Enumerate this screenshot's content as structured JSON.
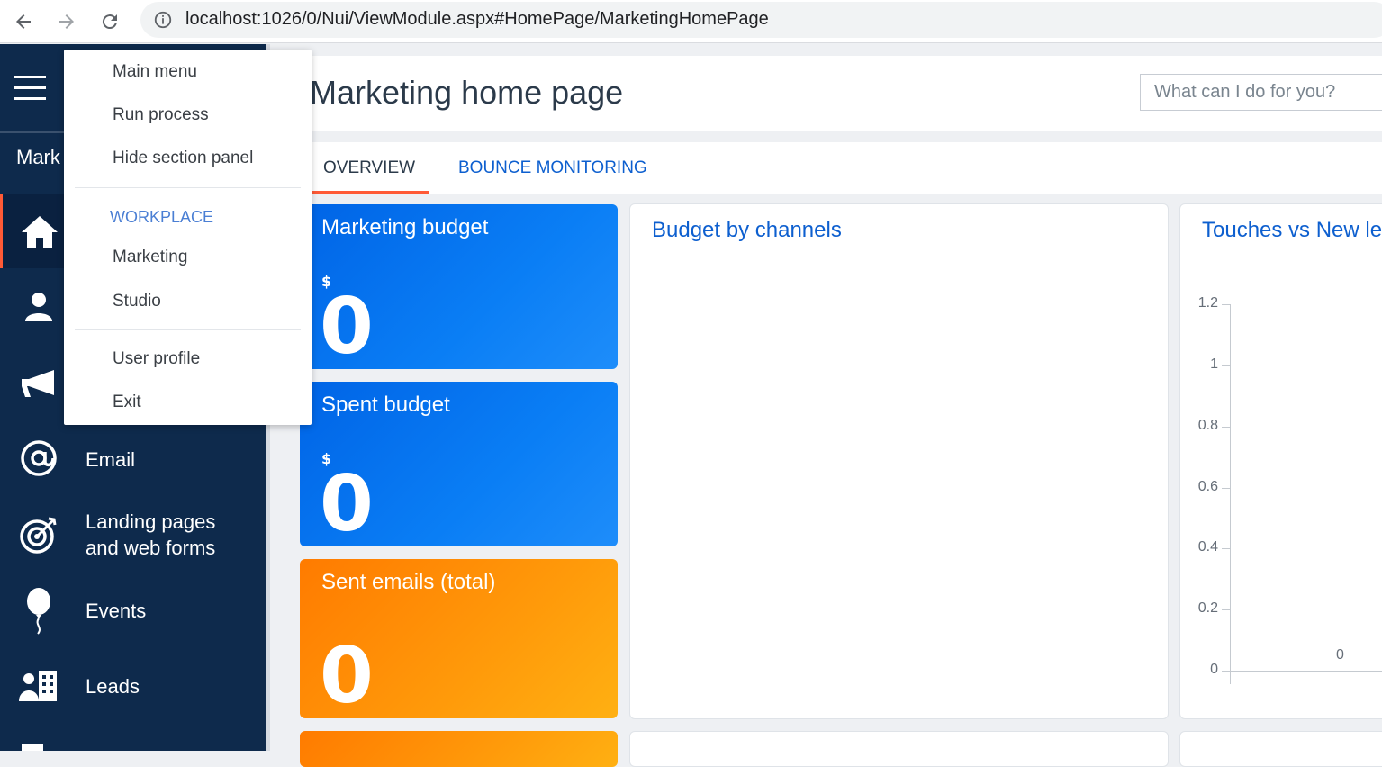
{
  "browser": {
    "url": "localhost:1026/0/Nui/ViewModule.aspx#HomePage/MarketingHomePage"
  },
  "sidebar": {
    "section_label": "Mark",
    "items": [
      {
        "label": "Email",
        "icon": "at-icon"
      },
      {
        "label": "Landing pages and web forms",
        "line1": "Landing pages",
        "line2": "and web forms",
        "icon": "target-icon"
      },
      {
        "label": "Events",
        "icon": "balloon-icon"
      },
      {
        "label": "Leads",
        "icon": "leads-icon"
      }
    ]
  },
  "header": {
    "title": "Marketing home page",
    "search_placeholder": "What can I do for you?"
  },
  "tabs": [
    {
      "label": "OVERVIEW",
      "active": true
    },
    {
      "label": "BOUNCE MONITORING",
      "active": false
    }
  ],
  "tiles": [
    {
      "title": "Marketing budget",
      "currency": "$",
      "value": "0"
    },
    {
      "title": "Spent budget",
      "currency": "$",
      "value": "0"
    },
    {
      "title": "Sent emails (total)",
      "value": "0"
    }
  ],
  "cards": {
    "budget_title": "Budget by channels",
    "touches_title": "Touches vs New le"
  },
  "chart_data": {
    "type": "bar",
    "title": "Touches vs New le",
    "yticks": [
      "1.2",
      "1",
      "0.8",
      "0.6",
      "0.4",
      "0.2",
      "0"
    ],
    "ylim": [
      0,
      1.2
    ],
    "values": [
      0
    ],
    "value_labels": [
      "0"
    ]
  },
  "menu": {
    "items_top": [
      "Main menu",
      "Run process",
      "Hide section panel"
    ],
    "workplace_header": "WORKPLACE",
    "workplace_items": [
      "Marketing",
      "Studio"
    ],
    "items_bottom": [
      "User profile",
      "Exit"
    ]
  },
  "colors": {
    "sidebar": "#0e2a4c",
    "accent": "#ff5a36",
    "link": "#0d5fcf",
    "tile_blue": "#0a7ef5",
    "tile_orange": "#ff9a0a"
  }
}
